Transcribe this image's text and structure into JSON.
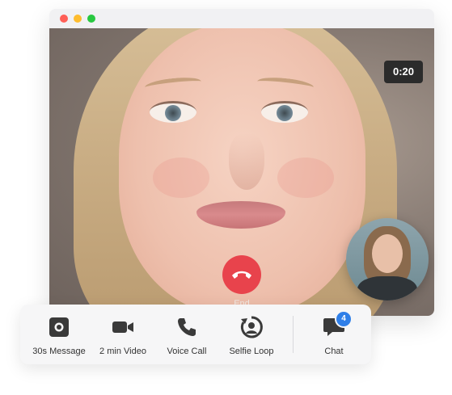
{
  "colors": {
    "dot_close": "#ff5f57",
    "dot_minimize": "#febc2e",
    "dot_maximize": "#28c840",
    "end_call": "#e8434c",
    "badge": "#2f7fe8",
    "icon": "#3a3a3a"
  },
  "call": {
    "timer": "0:20",
    "end_label": "End"
  },
  "toolbar": {
    "items": [
      {
        "label": "30s Message",
        "icon": "record-icon"
      },
      {
        "label": "2 min Video",
        "icon": "video-camera-icon"
      },
      {
        "label": "Voice Call",
        "icon": "phone-icon"
      },
      {
        "label": "Selfie Loop",
        "icon": "selfie-loop-icon"
      }
    ],
    "chat": {
      "label": "Chat",
      "icon": "chat-bubble-icon",
      "badge": "4"
    }
  }
}
